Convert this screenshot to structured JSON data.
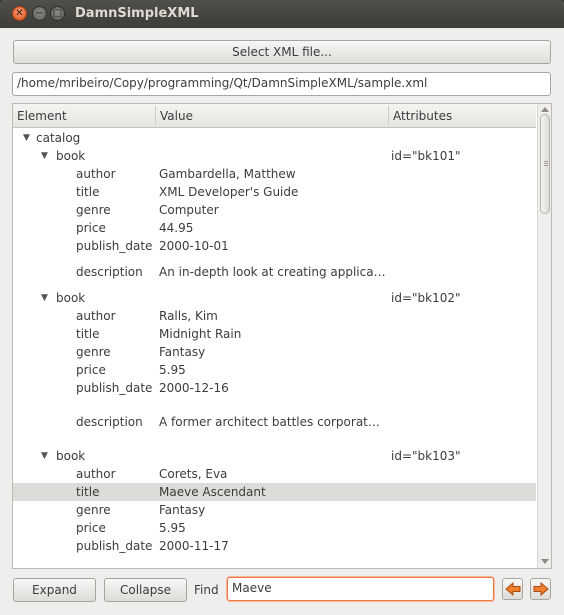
{
  "window": {
    "title": "DamnSimpleXML"
  },
  "toolbar": {
    "select_label": "Select XML file...",
    "path_value": "/home/mribeiro/Copy/programming/Qt/DamnSimpleXML/sample.xml"
  },
  "tree": {
    "columns": [
      "Element",
      "Value",
      "Attributes"
    ],
    "rows": [
      {
        "element": "catalog",
        "value": "",
        "attr": "",
        "level": 0,
        "expanded": true
      },
      {
        "element": "book",
        "value": "",
        "attr": "id=\"bk101\"",
        "level": 1,
        "expanded": true
      },
      {
        "element": "author",
        "value": "Gambardella, Matthew",
        "attr": "",
        "level": 2
      },
      {
        "element": "title",
        "value": "XML Developer's Guide",
        "attr": "",
        "level": 2
      },
      {
        "element": "genre",
        "value": "Computer",
        "attr": "",
        "level": 2
      },
      {
        "element": "price",
        "value": "44.95",
        "attr": "",
        "level": 2
      },
      {
        "element": "publish_date",
        "value": "2000-10-01",
        "attr": "",
        "level": 2
      },
      {
        "element": "description",
        "value": "An in-depth look at creating applica…",
        "attr": "",
        "level": 2
      },
      {
        "element": "book",
        "value": "",
        "attr": "id=\"bk102\"",
        "level": 1,
        "expanded": true
      },
      {
        "element": "author",
        "value": "Ralls, Kim",
        "attr": "",
        "level": 2
      },
      {
        "element": "title",
        "value": "Midnight Rain",
        "attr": "",
        "level": 2
      },
      {
        "element": "genre",
        "value": "Fantasy",
        "attr": "",
        "level": 2
      },
      {
        "element": "price",
        "value": "5.95",
        "attr": "",
        "level": 2
      },
      {
        "element": "publish_date",
        "value": "2000-12-16",
        "attr": "",
        "level": 2
      },
      {
        "element": "description",
        "value": "A former architect battles corporat…",
        "attr": "",
        "level": 2
      },
      {
        "element": "book",
        "value": "",
        "attr": "id=\"bk103\"",
        "level": 1,
        "expanded": true
      },
      {
        "element": "author",
        "value": "Corets, Eva",
        "attr": "",
        "level": 2
      },
      {
        "element": "title",
        "value": "Maeve Ascendant",
        "attr": "",
        "level": 2,
        "selected": true
      },
      {
        "element": "genre",
        "value": "Fantasy",
        "attr": "",
        "level": 2
      },
      {
        "element": "price",
        "value": "5.95",
        "attr": "",
        "level": 2
      },
      {
        "element": "publish_date",
        "value": "2000-11-17",
        "attr": "",
        "level": 2
      }
    ]
  },
  "bottom": {
    "expand_label": "Expand",
    "collapse_label": "Collapse",
    "find_label": "Find",
    "find_value": "Maeve"
  },
  "colors": {
    "accent": "#f07746",
    "selection": "#dedcd8",
    "titlebar": "#3d3c38"
  }
}
